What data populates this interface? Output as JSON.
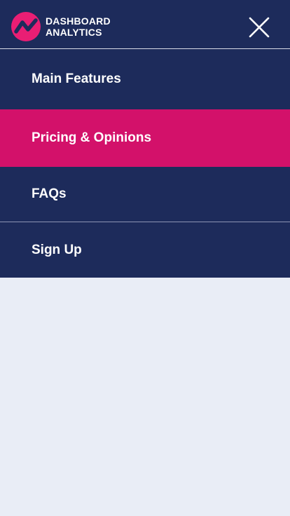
{
  "brand": {
    "line1": "DASHBOARD",
    "line2": "ANALYTICS",
    "accent_color": "#e91e74",
    "nav_color": "#1d2b5b"
  },
  "header": {
    "close_icon": "close-icon"
  },
  "menu": {
    "active_color": "#d3116a",
    "items": [
      {
        "label": "Main Features"
      },
      {
        "label": "Pricing & Opinions"
      },
      {
        "label": "FAQs"
      },
      {
        "label": "Sign Up"
      }
    ]
  }
}
